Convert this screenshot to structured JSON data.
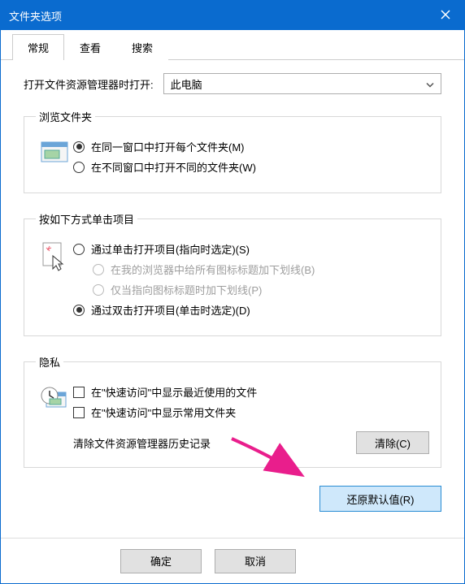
{
  "dialog": {
    "title": "文件夹选项"
  },
  "tabs": {
    "general": "常规",
    "view": "查看",
    "search": "搜索"
  },
  "general": {
    "openExplorerLabel": "打开文件资源管理器时打开:",
    "openExplorerValue": "此电脑",
    "browseGroup": "浏览文件夹",
    "browseSame": "在同一窗口中打开每个文件夹(M)",
    "browseNew": "在不同窗口中打开不同的文件夹(W)",
    "clickGroup": "按如下方式单击项目",
    "singleClick": "通过单击打开项目(指向时选定)(S)",
    "underlineBrowser": "在我的浏览器中给所有图标标题加下划线(B)",
    "underlinePoint": "仅当指向图标标题时加下划线(P)",
    "doubleClick": "通过双击打开项目(单击时选定)(D)",
    "privacyGroup": "隐私",
    "showRecent": "在\"快速访问\"中显示最近使用的文件",
    "showFrequent": "在\"快速访问\"中显示常用文件夹",
    "clearLabel": "清除文件资源管理器历史记录",
    "clearBtn": "清除(C)",
    "restoreBtn": "还原默认值(R)"
  },
  "footer": {
    "ok": "确定",
    "cancel": "取消"
  }
}
